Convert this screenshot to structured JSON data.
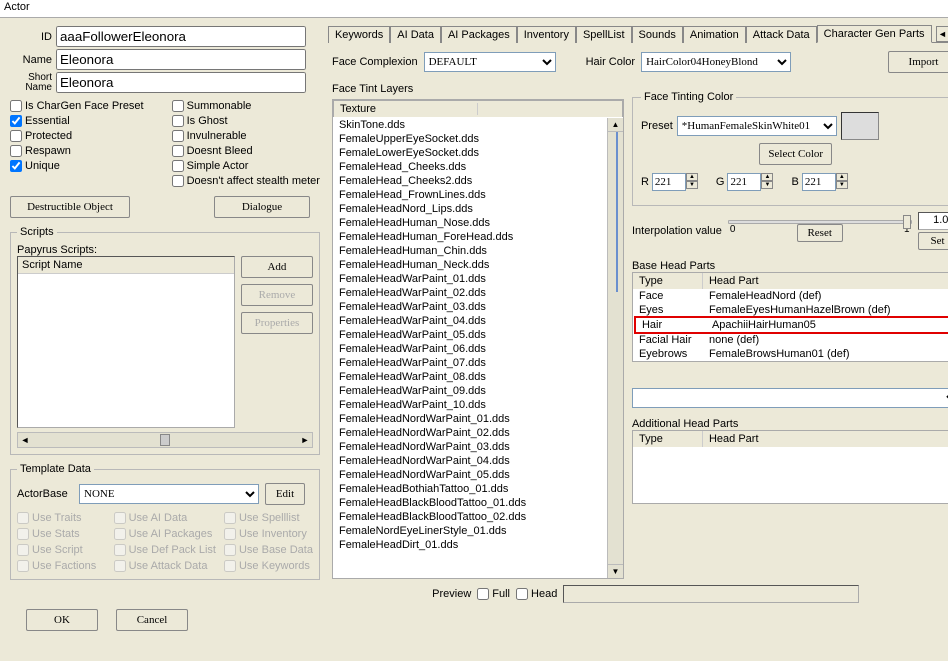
{
  "window": {
    "title": "Actor"
  },
  "left": {
    "id_label": "ID",
    "id_value": "aaaFollowerEleonora",
    "name_label": "Name",
    "name_value": "Eleonora",
    "short_label": "Short\nName",
    "short_value": "Eleonora",
    "flags_a": [
      {
        "label": "Is CharGen Face Preset",
        "checked": false
      },
      {
        "label": "Essential",
        "checked": true
      },
      {
        "label": "Protected",
        "checked": false
      },
      {
        "label": "Respawn",
        "checked": false
      },
      {
        "label": "Unique",
        "checked": true
      }
    ],
    "flags_b": [
      {
        "label": "Summonable",
        "checked": false
      },
      {
        "label": "Is Ghost",
        "checked": false
      },
      {
        "label": "Invulnerable",
        "checked": false
      },
      {
        "label": "Doesnt Bleed",
        "checked": false
      },
      {
        "label": "Simple Actor",
        "checked": false
      },
      {
        "label": "Doesn't affect stealth meter",
        "checked": false
      }
    ],
    "btn_destructible": "Destructible Object",
    "btn_dialogue": "Dialogue",
    "scripts_legend": "Scripts",
    "scripts_header": "Papyrus Scripts:",
    "script_col": "Script Name",
    "btn_add": "Add",
    "btn_remove": "Remove",
    "btn_props": "Properties",
    "tmpl_legend": "Template Data",
    "actorbase_label": "ActorBase",
    "actorbase_value": "NONE",
    "edit_btn": "Edit",
    "tmpl_opts": [
      "Use Traits",
      "Use AI Data",
      "Use Spelllist",
      "Use Stats",
      "Use AI Packages",
      "Use Inventory",
      "Use Script",
      "Use Def Pack List",
      "Use Base Data",
      "Use Factions",
      "Use Attack Data",
      "Use Keywords"
    ],
    "ok": "OK",
    "cancel": "Cancel"
  },
  "tabs": [
    "Keywords",
    "AI Data",
    "AI Packages",
    "Inventory",
    "SpellList",
    "Sounds",
    "Animation",
    "Attack Data",
    "Character Gen Parts"
  ],
  "active_tab": "Character Gen Parts",
  "gen": {
    "face_complexion_label": "Face Complexion",
    "face_complexion_value": "DEFAULT",
    "hair_color_label": "Hair Color",
    "hair_color_value": "HairColor04HoneyBlond",
    "import_btn": "Import",
    "face_tint_layers": "Face Tint Layers",
    "texture_col": "Texture",
    "textures": [
      "SkinTone.dds",
      "FemaleUpperEyeSocket.dds",
      "FemaleLowerEyeSocket.dds",
      "FemaleHead_Cheeks.dds",
      "FemaleHead_Cheeks2.dds",
      "FemaleHead_FrownLines.dds",
      "FemaleHeadNord_Lips.dds",
      "FemaleHeadHuman_Nose.dds",
      "FemaleHeadHuman_ForeHead.dds",
      "FemaleHeadHuman_Chin.dds",
      "FemaleHeadHuman_Neck.dds",
      "FemaleHeadWarPaint_01.dds",
      "FemaleHeadWarPaint_02.dds",
      "FemaleHeadWarPaint_03.dds",
      "FemaleHeadWarPaint_04.dds",
      "FemaleHeadWarPaint_05.dds",
      "FemaleHeadWarPaint_06.dds",
      "FemaleHeadWarPaint_07.dds",
      "FemaleHeadWarPaint_08.dds",
      "FemaleHeadWarPaint_09.dds",
      "FemaleHeadWarPaint_10.dds",
      "FemaleHeadNordWarPaint_01.dds",
      "FemaleHeadNordWarPaint_02.dds",
      "FemaleHeadNordWarPaint_03.dds",
      "FemaleHeadNordWarPaint_04.dds",
      "FemaleHeadNordWarPaint_05.dds",
      "FemaleHeadBothiahTattoo_01.dds",
      "FemaleHeadBlackBloodTattoo_01.dds",
      "FemaleHeadBlackBloodTattoo_02.dds",
      "FemaleNordEyeLinerStyle_01.dds",
      "FemaleHeadDirt_01.dds"
    ],
    "ftc_legend": "Face Tinting Color",
    "preset_label": "Preset",
    "preset_value": "*HumanFemaleSkinWhite01",
    "select_color": "Select Color",
    "r": "R",
    "g": "G",
    "b": "B",
    "r_val": "221",
    "g_val": "221",
    "b_val": "221",
    "interp_label": "Interpolation value",
    "interp_val": "1.00",
    "reset": "Reset",
    "set": "Set",
    "scale0": "0",
    "scale1": "1",
    "bhp": "Base Head Parts",
    "col_type": "Type",
    "col_hp": "Head Part",
    "bhp_rows": [
      {
        "type": "Face",
        "hp": "FemaleHeadNord (def)",
        "hl": false
      },
      {
        "type": "Eyes",
        "hp": "FemaleEyesHumanHazelBrown (def)",
        "hl": false
      },
      {
        "type": "Hair",
        "hp": "ApachiiHairHuman05",
        "hl": true
      },
      {
        "type": "Facial Hair",
        "hp": "none (def)",
        "hl": false
      },
      {
        "type": "Eyebrows",
        "hp": "FemaleBrowsHuman01 (def)",
        "hl": false
      }
    ],
    "ahp": "Additional Head Parts",
    "preview": "Preview",
    "full": "Full",
    "head": "Head"
  }
}
